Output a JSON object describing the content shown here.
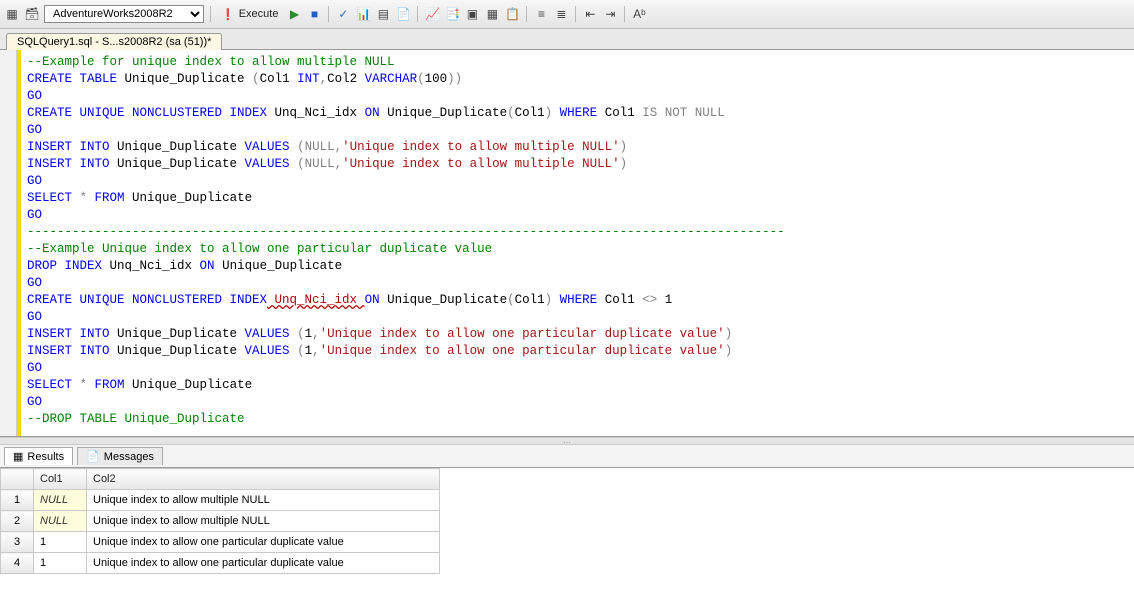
{
  "toolbar": {
    "database": "AdventureWorks2008R2",
    "execute_label": "Execute"
  },
  "tab": {
    "title": "SQLQuery1.sql - S...s2008R2 (sa (51))*"
  },
  "code": {
    "l1": "--Example for unique index to allow multiple NULL",
    "l2a": "CREATE TABLE",
    "l2b": " Unique_Duplicate ",
    "l2c": "(",
    "l2d": "Col1 ",
    "l2e": "INT",
    "l2f": ",",
    "l2g": "Col2 ",
    "l2h": "VARCHAR",
    "l2i": "(",
    "l2j": "100",
    "l2k": "))",
    "l3": "GO",
    "l4a": "CREATE UNIQUE NONCLUSTERED INDEX",
    "l4b": " Unq_Nci_idx ",
    "l4c": "ON",
    "l4d": " Unique_Duplicate",
    "l4e": "(",
    "l4f": "Col1",
    "l4g": ")",
    "l4h": " WHERE",
    "l4i": " Col1 ",
    "l4j": "IS NOT NULL",
    "l5": "GO",
    "l6a": "INSERT INTO",
    "l6b": " Unique_Duplicate ",
    "l6c": "VALUES ",
    "l6d": "(",
    "l6e": "NULL",
    "l6f": ",",
    "l6g": "'Unique index to allow multiple NULL'",
    "l6h": ")",
    "l7a": "INSERT INTO",
    "l7b": " Unique_Duplicate ",
    "l7c": "VALUES ",
    "l7d": "(",
    "l7e": "NULL",
    "l7f": ",",
    "l7g": "'Unique index to allow multiple NULL'",
    "l7h": ")",
    "l8": "GO",
    "l9a": "SELECT",
    "l9b": " * ",
    "l9c": "FROM",
    "l9d": " Unique_Duplicate",
    "l10": "GO",
    "l11": "-----------------------------------------------------------------------------------------------------",
    "l12": "--Example Unique index to allow one particular duplicate value",
    "l13a": "DROP INDEX",
    "l13b": " Unq_Nci_idx ",
    "l13c": "ON",
    "l13d": " Unique_Duplicate",
    "l14": "GO",
    "l15a": "CREATE UNIQUE NONCLUSTERED INDEX",
    "l15b": " Unq_Nci_idx ",
    "l15c": "ON",
    "l15d": " Unique_Duplicate",
    "l15e": "(",
    "l15f": "Col1",
    "l15g": ")",
    "l15h": " WHERE",
    "l15i": " Col1 ",
    "l15j": "<>",
    "l15k": " 1",
    "l16": "GO",
    "l17a": "INSERT INTO",
    "l17b": " Unique_Duplicate ",
    "l17c": "VALUES ",
    "l17d": "(",
    "l17e": "1",
    "l17f": ",",
    "l17g": "'Unique index to allow one particular duplicate value'",
    "l17h": ")",
    "l18a": "INSERT INTO",
    "l18b": " Unique_Duplicate ",
    "l18c": "VALUES ",
    "l18d": "(",
    "l18e": "1",
    "l18f": ",",
    "l18g": "'Unique index to allow one particular duplicate value'",
    "l18h": ")",
    "l19": "GO",
    "l20a": "SELECT",
    "l20b": " * ",
    "l20c": "FROM",
    "l20d": " Unique_Duplicate",
    "l21": "GO",
    "l22": "--DROP TABLE Unique_Duplicate"
  },
  "results": {
    "tab_results": "Results",
    "tab_messages": "Messages",
    "columns": {
      "rownum": "",
      "col1": "Col1",
      "col2": "Col2"
    },
    "rows": [
      {
        "n": "1",
        "c1": "NULL",
        "c2": "Unique index to allow multiple NULL",
        "null": true
      },
      {
        "n": "2",
        "c1": "NULL",
        "c2": "Unique index to allow multiple NULL",
        "null": true
      },
      {
        "n": "3",
        "c1": "1",
        "c2": "Unique index to allow one particular duplicate value",
        "null": false
      },
      {
        "n": "4",
        "c1": "1",
        "c2": "Unique index to allow one particular duplicate value",
        "null": false
      }
    ]
  }
}
